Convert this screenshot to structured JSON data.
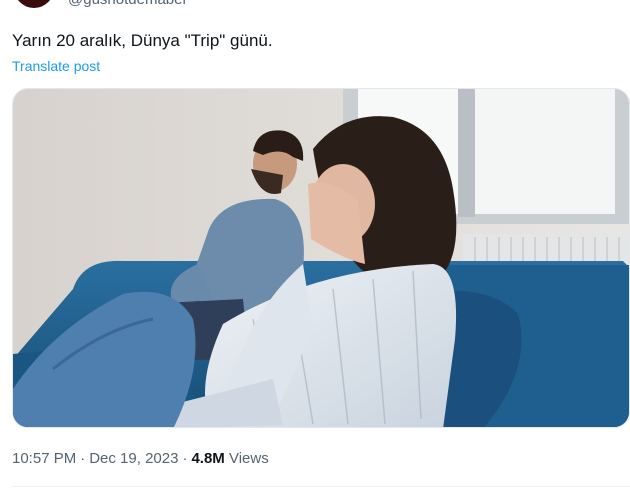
{
  "author": {
    "handle": "@gushotdemaber"
  },
  "tweet": {
    "text": "Yarın 20 aralık, Dünya \"Trip\" günü.",
    "translate_label": "Translate post",
    "image": {
      "subject": "couple-on-sofa-photo"
    }
  },
  "meta": {
    "time": "10:57 PM",
    "separator": "·",
    "date": "Dec 19, 2023",
    "views_count": "4.8M",
    "views_label": "Views"
  },
  "colors": {
    "link": "#1d9bf0",
    "secondary_text": "#536471",
    "primary_text": "#0f1419",
    "sofa": "#1f5f8f"
  }
}
